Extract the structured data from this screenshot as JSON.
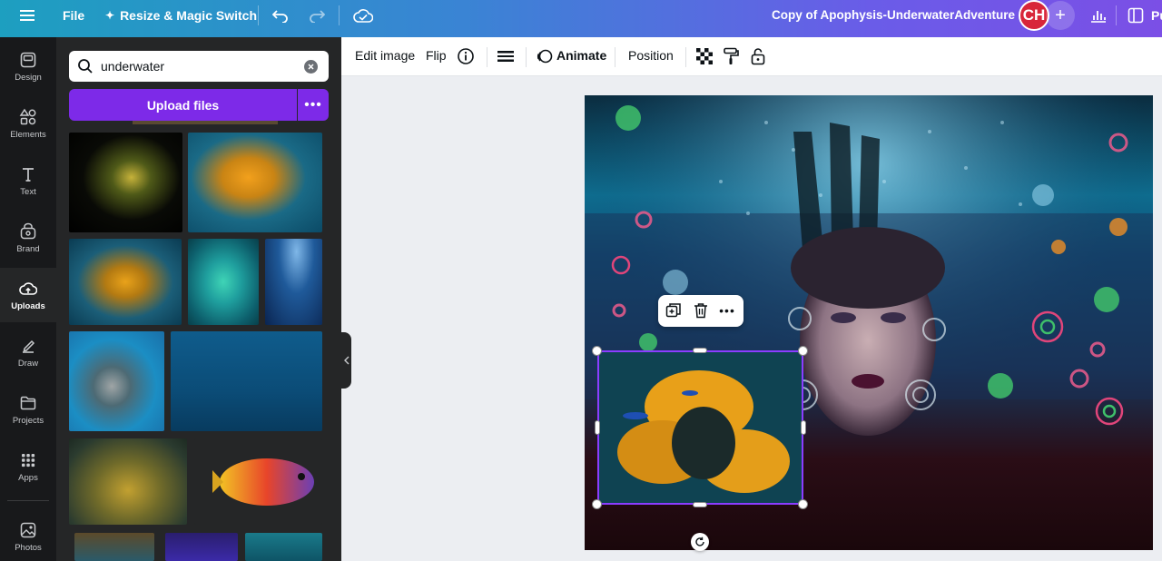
{
  "topbar": {
    "menu_icon": "hamburger-icon",
    "file_label": "File",
    "resize_label": "Resize & Magic Switch",
    "doc_title": "Copy of Apophysis-UnderwaterAdventure",
    "avatar_initials": "CH",
    "share_label": "Pu"
  },
  "rail": {
    "items": [
      {
        "label": "Design",
        "icon": "design-icon"
      },
      {
        "label": "Elements",
        "icon": "elements-icon"
      },
      {
        "label": "Text",
        "icon": "text-icon"
      },
      {
        "label": "Brand",
        "icon": "brand-icon"
      },
      {
        "label": "Uploads",
        "icon": "upload-cloud-icon"
      },
      {
        "label": "Draw",
        "icon": "draw-icon"
      },
      {
        "label": "Projects",
        "icon": "folder-icon"
      },
      {
        "label": "Apps",
        "icon": "apps-grid-icon"
      },
      {
        "label": "Photos",
        "icon": "photo-icon"
      }
    ],
    "active": "Uploads"
  },
  "panel": {
    "search_value": "underwater",
    "upload_label": "Upload files"
  },
  "context_toolbar": {
    "edit_image": "Edit image",
    "flip": "Flip",
    "animate": "Animate",
    "position": "Position"
  },
  "colors": {
    "accent": "#7d2ae8",
    "selection": "#8b3dff",
    "avatar": "#d8263a"
  }
}
